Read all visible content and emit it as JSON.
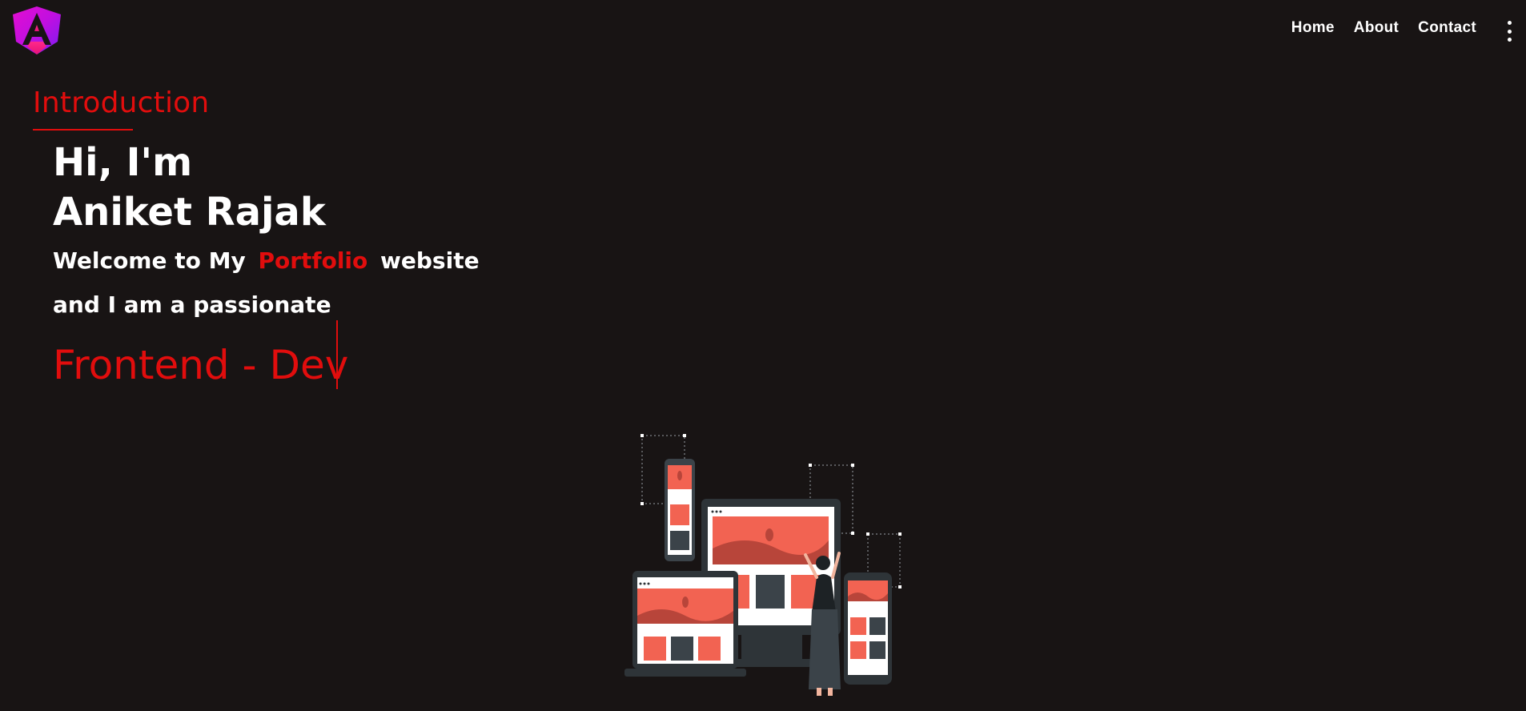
{
  "header": {
    "logo_icon": "angular-logo-icon",
    "nav": [
      {
        "label": "Home"
      },
      {
        "label": "About"
      },
      {
        "label": "Contact"
      }
    ],
    "menu_icon": "more-vertical-icon"
  },
  "intro": {
    "section_label": "Introduction",
    "greeting": "Hi, I'm",
    "name": "Aniket Rajak",
    "welcome_prefix": "Welcome to My",
    "welcome_highlight": "Portfolio",
    "welcome_suffix": "website",
    "passion_line": "and I am a passionate",
    "role": "Frontend - Dev"
  },
  "colors": {
    "background": "#181414",
    "accent": "#e10d0d",
    "text": "#ffffff",
    "illustration_coral": "#f26352",
    "illustration_dark": "#3b4349"
  },
  "illustration_icon": "responsive-devices-illustration"
}
